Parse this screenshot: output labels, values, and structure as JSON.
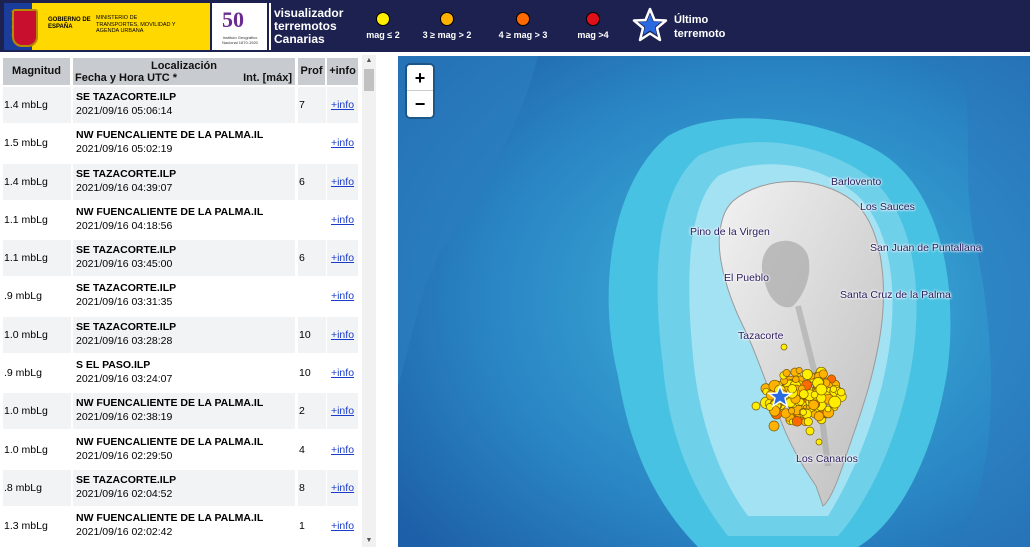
{
  "header": {
    "gov_line1": "GOBIERNO DE ESPAÑA",
    "gov_line2": "MINISTERIO DE TRANSPORTES, MOVILIDAD Y AGENDA URBANA",
    "ign_number": "50",
    "ign_sub": "Instituto Geográfico Nacional 1870-1920",
    "title": "visualizador terremotos Canarias",
    "legend": [
      {
        "label": "mag ≤ 2",
        "color": "#ffee00"
      },
      {
        "label": "3 ≥ mag > 2",
        "color": "#ffb300"
      },
      {
        "label": "4 ≥ mag > 3",
        "color": "#ff6a00"
      },
      {
        "label": "mag >4",
        "color": "#e0101a"
      }
    ],
    "last_label": "Último terremoto",
    "star_icon": "star-icon"
  },
  "table": {
    "col_mag": "Magnitud",
    "col_loc": "Localización",
    "col_date": "Fecha y Hora UTC *",
    "col_int": "Int. [máx]",
    "col_prof": "Prof",
    "col_info": "+info",
    "rows": [
      {
        "mag": "1.4 mbLg",
        "place": "SE TAZACORTE.ILP",
        "date": "2021/09/16 05:06:14",
        "prof": "7",
        "info": "+info"
      },
      {
        "mag": "1.5 mbLg",
        "place": "NW FUENCALIENTE DE LA PALMA.IL",
        "date": "2021/09/16 05:02:19",
        "prof": "",
        "info": "+info"
      },
      {
        "mag": "1.4 mbLg",
        "place": "SE TAZACORTE.ILP",
        "date": "2021/09/16 04:39:07",
        "prof": "6",
        "info": "+info"
      },
      {
        "mag": "1.1 mbLg",
        "place": "NW FUENCALIENTE DE LA PALMA.IL",
        "date": "2021/09/16 04:18:56",
        "prof": "",
        "info": "+info"
      },
      {
        "mag": "1.1 mbLg",
        "place": "SE TAZACORTE.ILP",
        "date": "2021/09/16 03:45:00",
        "prof": "6",
        "info": "+info"
      },
      {
        "mag": ".9 mbLg",
        "place": "SE TAZACORTE.ILP",
        "date": "2021/09/16 03:31:35",
        "prof": "",
        "info": "+info"
      },
      {
        "mag": "1.0 mbLg",
        "place": "SE TAZACORTE.ILP",
        "date": "2021/09/16 03:28:28",
        "prof": "10",
        "info": "+info"
      },
      {
        "mag": ".9 mbLg",
        "place": "S EL PASO.ILP",
        "date": "2021/09/16 03:24:07",
        "prof": "10",
        "info": "+info"
      },
      {
        "mag": "1.0 mbLg",
        "place": "NW FUENCALIENTE DE LA PALMA.IL",
        "date": "2021/09/16 02:38:19",
        "prof": "2",
        "info": "+info"
      },
      {
        "mag": "1.0 mbLg",
        "place": "NW FUENCALIENTE DE LA PALMA.IL",
        "date": "2021/09/16 02:29:50",
        "prof": "4",
        "info": "+info"
      },
      {
        "mag": ".8 mbLg",
        "place": "SE TAZACORTE.ILP",
        "date": "2021/09/16 02:04:52",
        "prof": "8",
        "info": "+info"
      },
      {
        "mag": "1.3 mbLg",
        "place": "NW FUENCALIENTE DE LA PALMA.IL",
        "date": "2021/09/16 02:02:42",
        "prof": "1",
        "info": "+info"
      }
    ]
  },
  "map": {
    "zoom_in": "+",
    "zoom_out": "−",
    "towns": {
      "barlovento": "Barlovento",
      "los_sauces": "Los Sauces",
      "pino": "Pino de la Virgen",
      "san_juan": "San Juan de Puntallana",
      "el_pueblo": "El Pueblo",
      "santa_cruz": "Santa Cruz de la Palma",
      "tazacorte": "Tazacorte",
      "los_canarios": "Los Canarios"
    }
  }
}
